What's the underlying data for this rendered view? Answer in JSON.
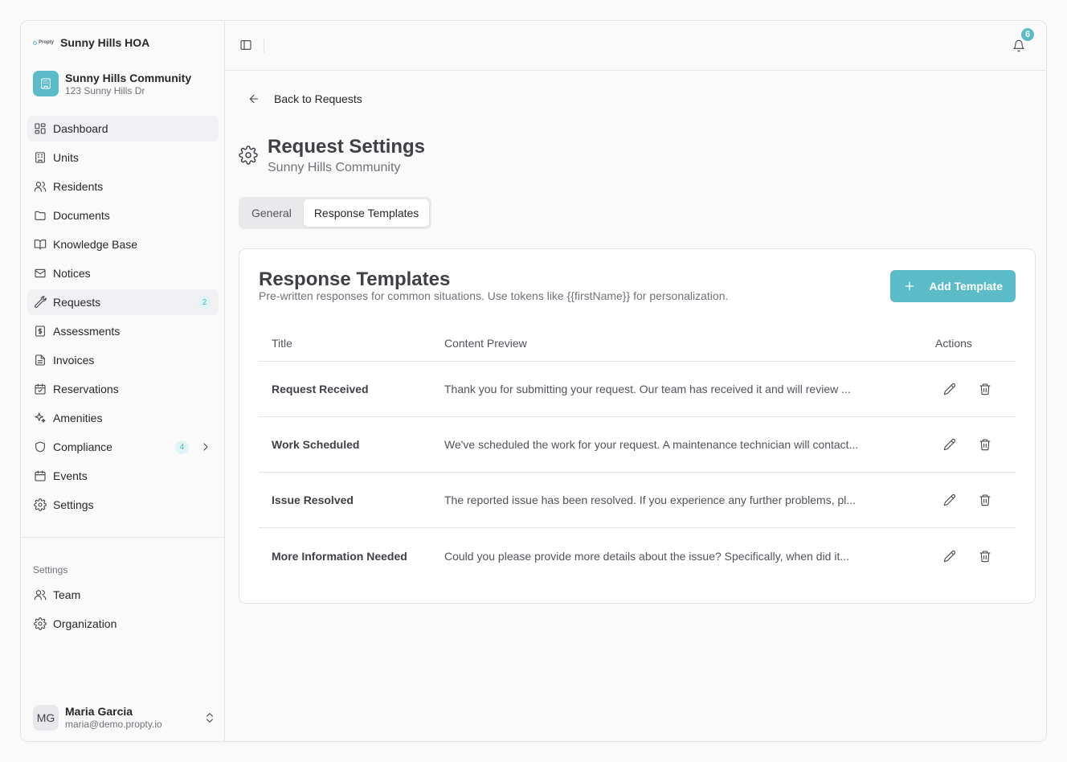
{
  "app": {
    "brand_logo_text": "Propty",
    "org_name": "Sunny Hills HOA",
    "community": {
      "name": "Sunny Hills Community",
      "address": "123 Sunny Hills Dr"
    }
  },
  "sidebar": {
    "items": [
      {
        "label": "Dashboard",
        "icon": "dashboard-icon"
      },
      {
        "label": "Units",
        "icon": "building-icon"
      },
      {
        "label": "Residents",
        "icon": "users-icon"
      },
      {
        "label": "Documents",
        "icon": "folder-icon"
      },
      {
        "label": "Knowledge Base",
        "icon": "book-icon"
      },
      {
        "label": "Notices",
        "icon": "mail-icon"
      },
      {
        "label": "Requests",
        "icon": "wrench-icon",
        "badge": "2"
      },
      {
        "label": "Assessments",
        "icon": "dollar-file-icon"
      },
      {
        "label": "Invoices",
        "icon": "file-icon"
      },
      {
        "label": "Reservations",
        "icon": "calendar-check-icon"
      },
      {
        "label": "Amenities",
        "icon": "sparkles-icon"
      },
      {
        "label": "Compliance",
        "icon": "shield-icon",
        "badge": "4"
      },
      {
        "label": "Events",
        "icon": "calendar-icon"
      },
      {
        "label": "Settings",
        "icon": "gear-icon"
      }
    ],
    "settings_group_label": "Settings",
    "settings_items": [
      {
        "label": "Team",
        "icon": "users-icon"
      },
      {
        "label": "Organization",
        "icon": "gear-icon"
      }
    ],
    "user": {
      "initials": "MG",
      "name": "Maria Garcia",
      "email": "maria@demo.propty.io"
    }
  },
  "topbar": {
    "notification_count": "6"
  },
  "page": {
    "back_label": "Back to Requests",
    "title": "Request Settings",
    "subtitle": "Sunny Hills Community",
    "tabs": [
      {
        "label": "General"
      },
      {
        "label": "Response Templates"
      }
    ],
    "active_tab": "Response Templates"
  },
  "templates_card": {
    "title": "Response Templates",
    "description": "Pre-written responses for common situations. Use tokens like {{firstName}} for personalization.",
    "add_button_label": "Add Template",
    "columns": {
      "title": "Title",
      "content": "Content Preview",
      "actions": "Actions"
    },
    "rows": [
      {
        "title": "Request Received",
        "content": "Thank you for submitting your request. Our team has received it and will review ..."
      },
      {
        "title": "Work Scheduled",
        "content": "We've scheduled the work for your request. A maintenance technician will contact..."
      },
      {
        "title": "Issue Resolved",
        "content": "The reported issue has been resolved. If you experience any further problems, pl..."
      },
      {
        "title": "More Information Needed",
        "content": "Could you please provide more details about the issue? Specifically, when did it..."
      }
    ]
  },
  "colors": {
    "accent": "#5bbcc8",
    "accent_soft": "#e0f4f6",
    "text": "#27272a",
    "muted": "#71717a",
    "border": "#e4e4e7"
  }
}
